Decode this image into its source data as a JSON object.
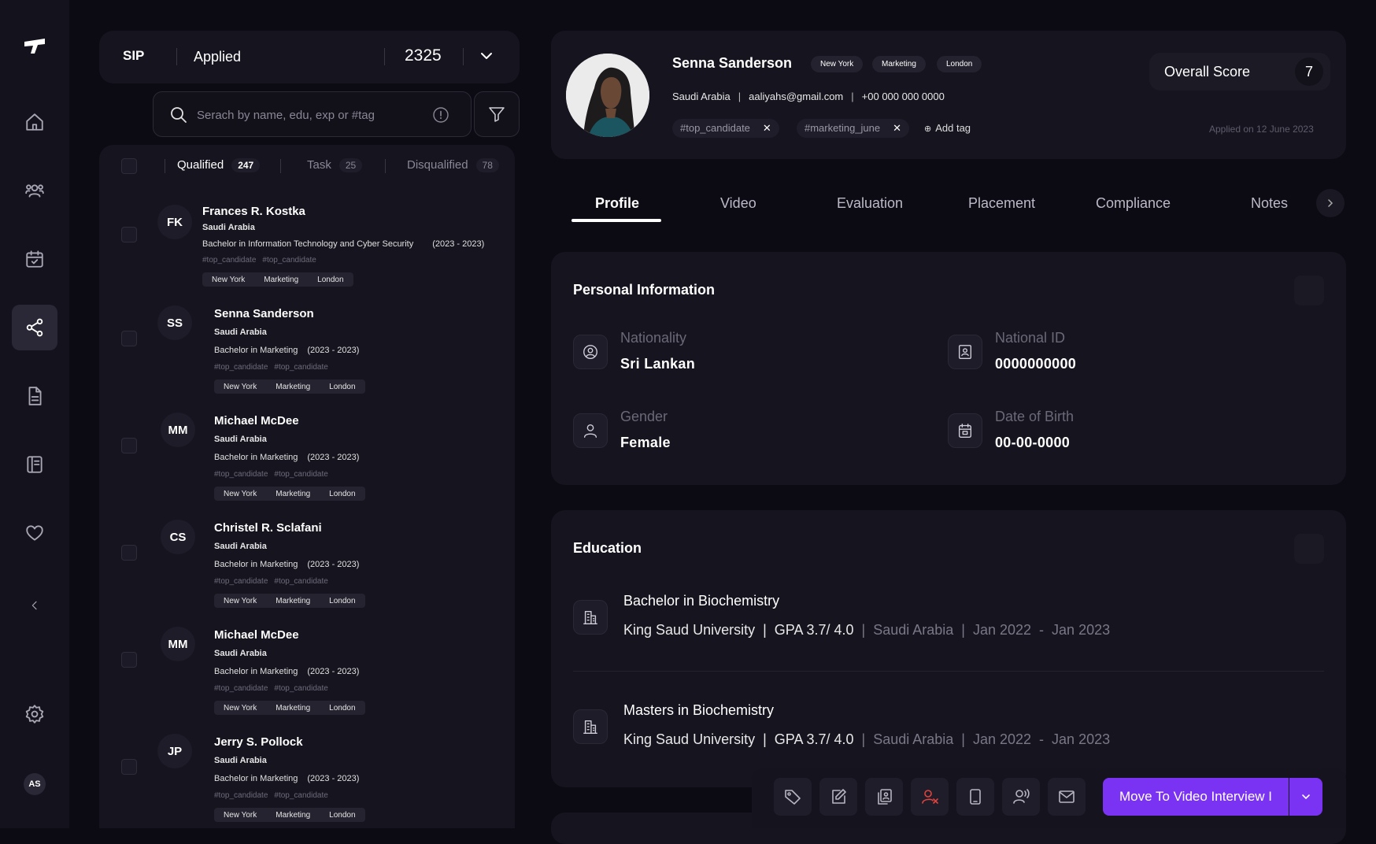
{
  "stage": {
    "code": "SIP",
    "name": "Applied",
    "count": "2325"
  },
  "search": {
    "placeholder": "Serach by name, edu, exp or #tag"
  },
  "list_tabs": [
    {
      "label": "Qualified",
      "count": "247"
    },
    {
      "label": "Task",
      "count": "25"
    },
    {
      "label": "Disqualified",
      "count": "78"
    }
  ],
  "candidates": [
    {
      "initials": "FK",
      "name": "Frances R. Kostka",
      "country": "Saudi Arabia",
      "degree": "Bachelor in Information Technology and Cyber Security",
      "years": "(2023 - 2023)",
      "tags": [
        "#top_candidate",
        "#top_candidate"
      ],
      "pills": [
        "New York",
        "Marketing",
        "London"
      ]
    },
    {
      "initials": "SS",
      "name": "Senna Sanderson",
      "country": "Saudi Arabia",
      "degree": "Bachelor in Marketing",
      "years": "(2023 - 2023)",
      "tags": [
        "#top_candidate",
        "#top_candidate"
      ],
      "pills": [
        "New York",
        "Marketing",
        "London"
      ]
    },
    {
      "initials": "MM",
      "name": "Michael McDee",
      "country": "Saudi Arabia",
      "degree": "Bachelor in Marketing",
      "years": "(2023 - 2023)",
      "tags": [
        "#top_candidate",
        "#top_candidate"
      ],
      "pills": [
        "New York",
        "Marketing",
        "London"
      ]
    },
    {
      "initials": "CS",
      "name": "Christel R. Sclafani",
      "country": "Saudi Arabia",
      "degree": "Bachelor in Marketing",
      "years": "(2023 - 2023)",
      "tags": [
        "#top_candidate",
        "#top_candidate"
      ],
      "pills": [
        "New York",
        "Marketing",
        "London"
      ]
    },
    {
      "initials": "MM",
      "name": "Michael McDee",
      "country": "Saudi Arabia",
      "degree": "Bachelor in Marketing",
      "years": "(2023 - 2023)",
      "tags": [
        "#top_candidate",
        "#top_candidate"
      ],
      "pills": [
        "New York",
        "Marketing",
        "London"
      ]
    },
    {
      "initials": "JP",
      "name": "Jerry S. Pollock",
      "country": "Saudi Arabia",
      "degree": "Bachelor in Marketing",
      "years": "(2023 - 2023)",
      "tags": [
        "#top_candidate",
        "#top_candidate"
      ],
      "pills": [
        "New York",
        "Marketing",
        "London"
      ]
    }
  ],
  "profile": {
    "name": "Senna Sanderson",
    "pills": [
      "New York",
      "Marketing",
      "London"
    ],
    "country": "Saudi Arabia",
    "email": "aaliyahs@gmail.com",
    "phone": "+00 000 000 0000",
    "tags": [
      "#top_candidate",
      "#marketing_june"
    ],
    "add_tag": "Add tag",
    "score_label": "Overall Score",
    "score": "7",
    "applied_on": "Applied on 12 June 2023"
  },
  "tabs": [
    "Profile",
    "Video",
    "Evaluation",
    "Placement",
    "Compliance",
    "Notes"
  ],
  "personal": {
    "title": "Personal Information",
    "fields": [
      {
        "label": "Nationality",
        "value": "Sri Lankan",
        "icon": "user-circle-icon"
      },
      {
        "label": "National ID",
        "value": "0000000000",
        "icon": "id-card-icon"
      },
      {
        "label": "Gender",
        "value": "Female",
        "icon": "person-icon"
      },
      {
        "label": "Date of Birth",
        "value": "00-00-0000",
        "icon": "calendar-icon"
      }
    ]
  },
  "education": {
    "title": "Education",
    "items": [
      {
        "degree": "Bachelor in Biochemistry",
        "university": "King Saud University",
        "gpa": "GPA 3.7/ 4.0",
        "country": "Saudi Arabia",
        "start": "Jan 2022",
        "end": "Jan 2023"
      },
      {
        "degree": "Masters in Biochemistry",
        "university": "King Saud University",
        "gpa": "GPA 3.7/ 4.0",
        "country": "Saudi Arabia",
        "start": "Jan 2022",
        "end": "Jan 2023"
      }
    ]
  },
  "actions": {
    "primary": "Move To Video Interview I"
  },
  "user": {
    "initials": "AS"
  },
  "colors": {
    "accent": "#7b33f3",
    "background": "#0c0b14",
    "panel": "#16141f",
    "danger": "#e0443e"
  }
}
